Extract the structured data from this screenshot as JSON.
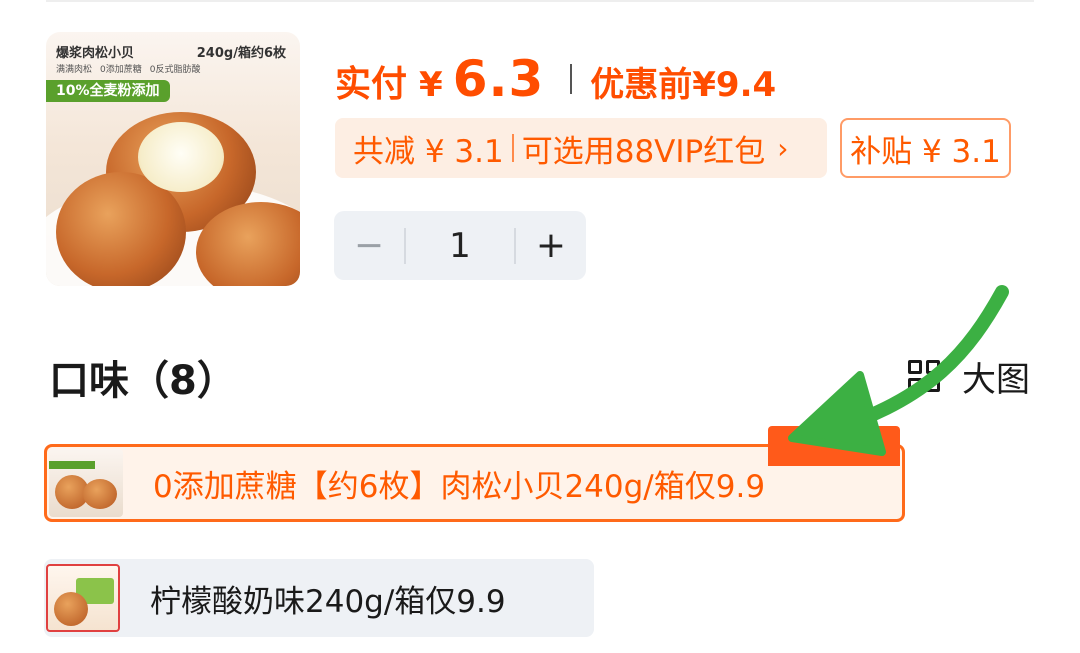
{
  "product": {
    "thumb_name": "爆浆肉松小贝",
    "thumb_spec": "240g/箱约6枚",
    "thumb_tags": [
      "满满肉松",
      "0添加蔗糖",
      "0反式脂肪酸"
    ],
    "thumb_badge": "10%全麦粉添加"
  },
  "price": {
    "paid_label": "实付",
    "currency": "¥",
    "paid_value": "6.3",
    "before_label": "优惠前",
    "before_value": "¥9.4"
  },
  "discount": {
    "total_text": "共减 ¥ 3.1",
    "vip_text": "可选用88VIP红包",
    "chevron": "›",
    "subsidy_text": "补贴 ¥ 3.1"
  },
  "stepper": {
    "minus": "−",
    "quantity": "1",
    "plus": "+"
  },
  "flavor_section": {
    "title": "口味（8）",
    "view_toggle": "大图",
    "options": [
      {
        "label": "0添加蔗糖【约6枚】肉松小贝240g/箱仅9.9",
        "selected": true
      },
      {
        "label": "柠檬酸奶味240g/箱仅9.9",
        "selected": false
      }
    ]
  },
  "colors": {
    "accent": "#ff4d00",
    "annotation_arrow": "#3cb043"
  }
}
